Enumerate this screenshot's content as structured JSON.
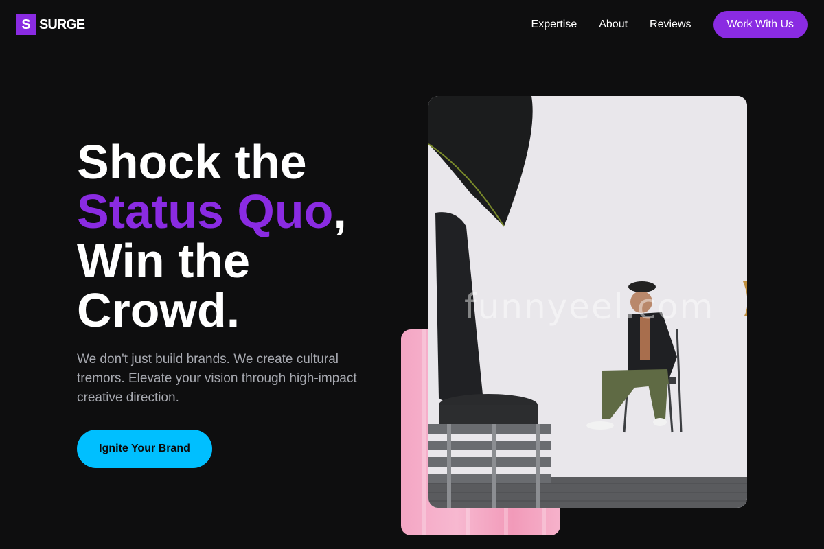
{
  "brand": {
    "mark": "S",
    "name": "SURGE",
    "accent_color": "#8a2be2"
  },
  "nav": {
    "links": [
      {
        "label": "Expertise"
      },
      {
        "label": "About"
      },
      {
        "label": "Reviews"
      }
    ],
    "cta_label": "Work With Us"
  },
  "hero": {
    "title_line1": "Shock the",
    "title_accent": "Status Quo",
    "title_comma": ",",
    "title_line3": "Win the",
    "title_line4": "Crowd.",
    "subtitle": "We don't just build brands. We create cultural tremors. Elevate your vision through high-impact creative direction.",
    "cta_label": "Ignite Your Brand",
    "cta_color": "#00bfff"
  },
  "media": {
    "watermark": "funnyeel.com",
    "main_image_icon": "photo-studio-image",
    "back_image_icon": "pink-curtain-image"
  }
}
